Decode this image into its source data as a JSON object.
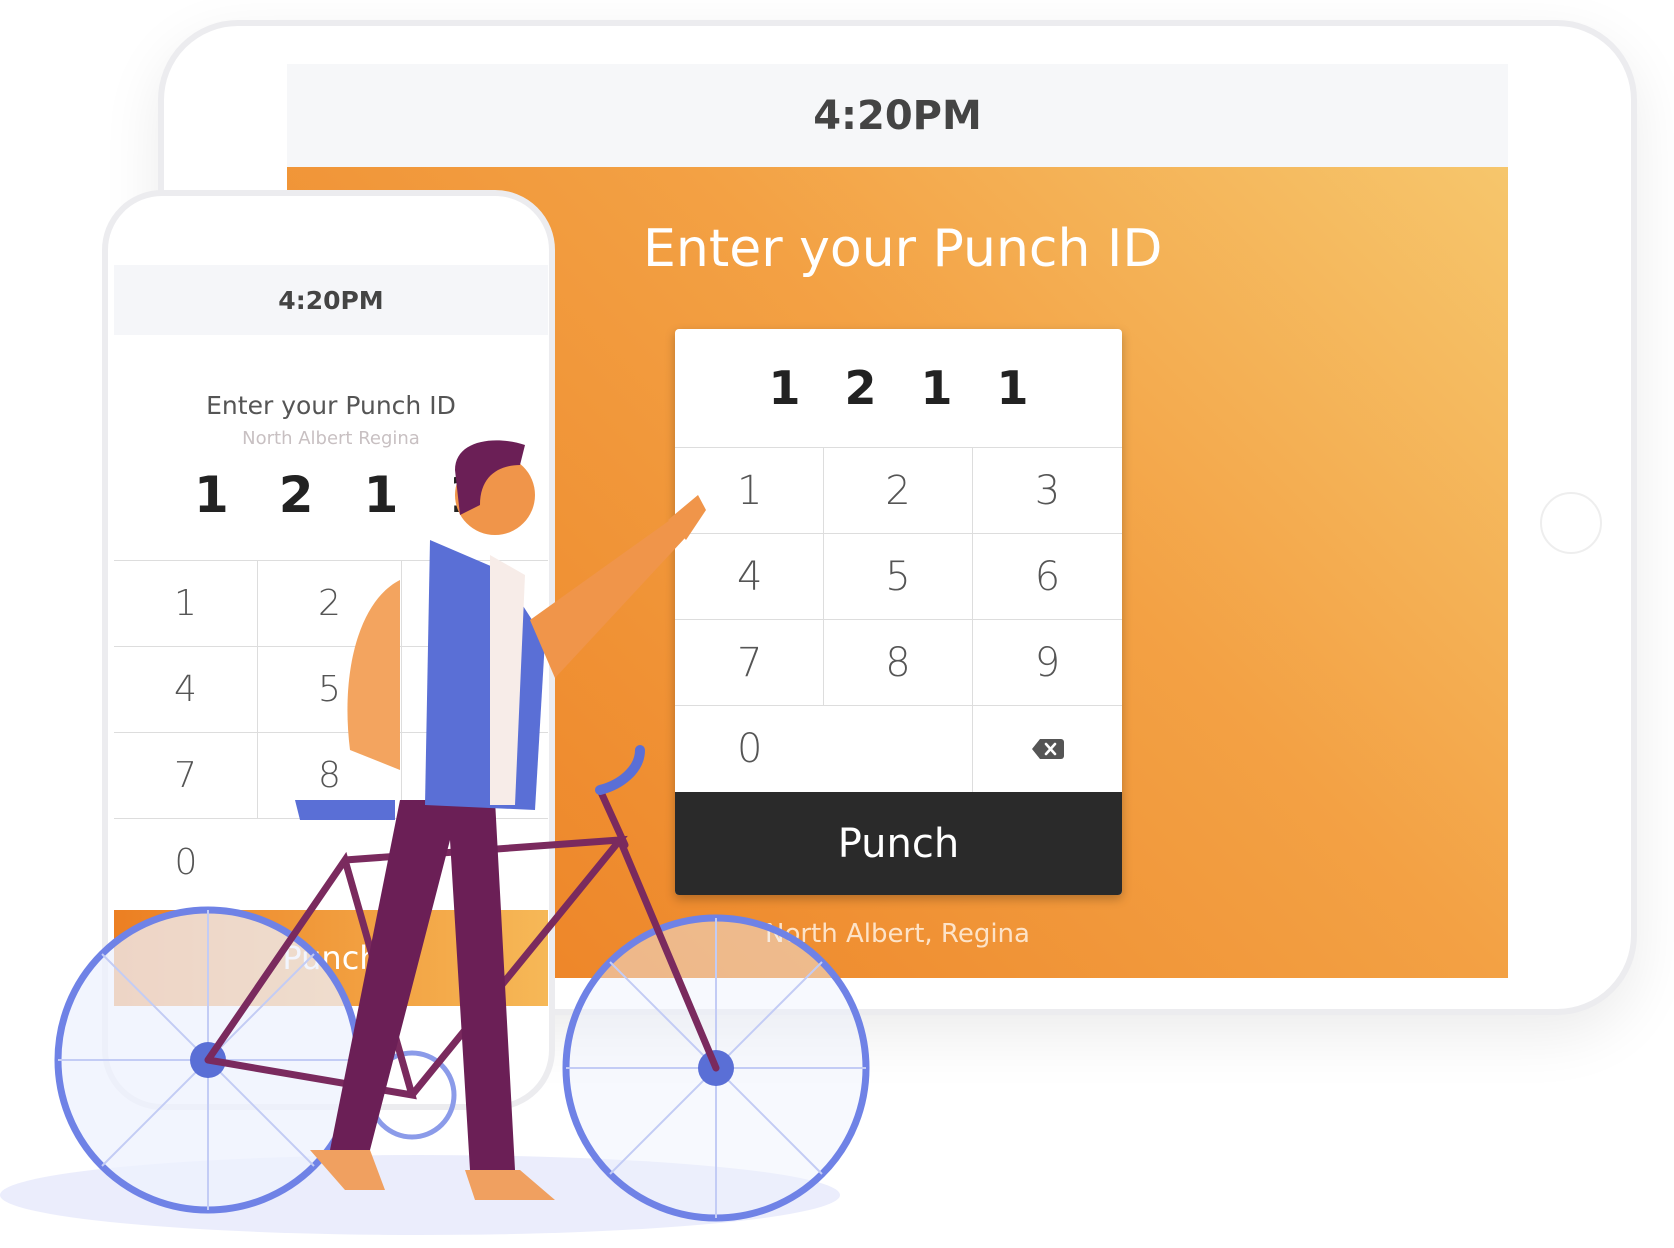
{
  "tablet": {
    "time": "4:20PM",
    "title": "Enter your Punch ID",
    "entered_digits": [
      "1",
      "2",
      "1",
      "1"
    ],
    "keys": [
      "1",
      "2",
      "3",
      "4",
      "5",
      "6",
      "7",
      "8",
      "9",
      "0"
    ],
    "backspace_icon": "backspace-icon",
    "punch_label": "Punch",
    "location": "North Albert, Regina"
  },
  "phone": {
    "time": "4:20PM",
    "title": "Enter your Punch ID",
    "location": "North Albert Regina",
    "entered_digits": [
      "1",
      "2",
      "1",
      "1"
    ],
    "keys": [
      "1",
      "2",
      "4",
      "5",
      "7",
      "8",
      "0"
    ],
    "punch_label": "Punch"
  },
  "colors": {
    "accent_orange": "#ec7f22",
    "button_dark": "#2a2a2a",
    "illustration_blue": "#5a6fd6",
    "illustration_purple": "#6b1f56"
  }
}
